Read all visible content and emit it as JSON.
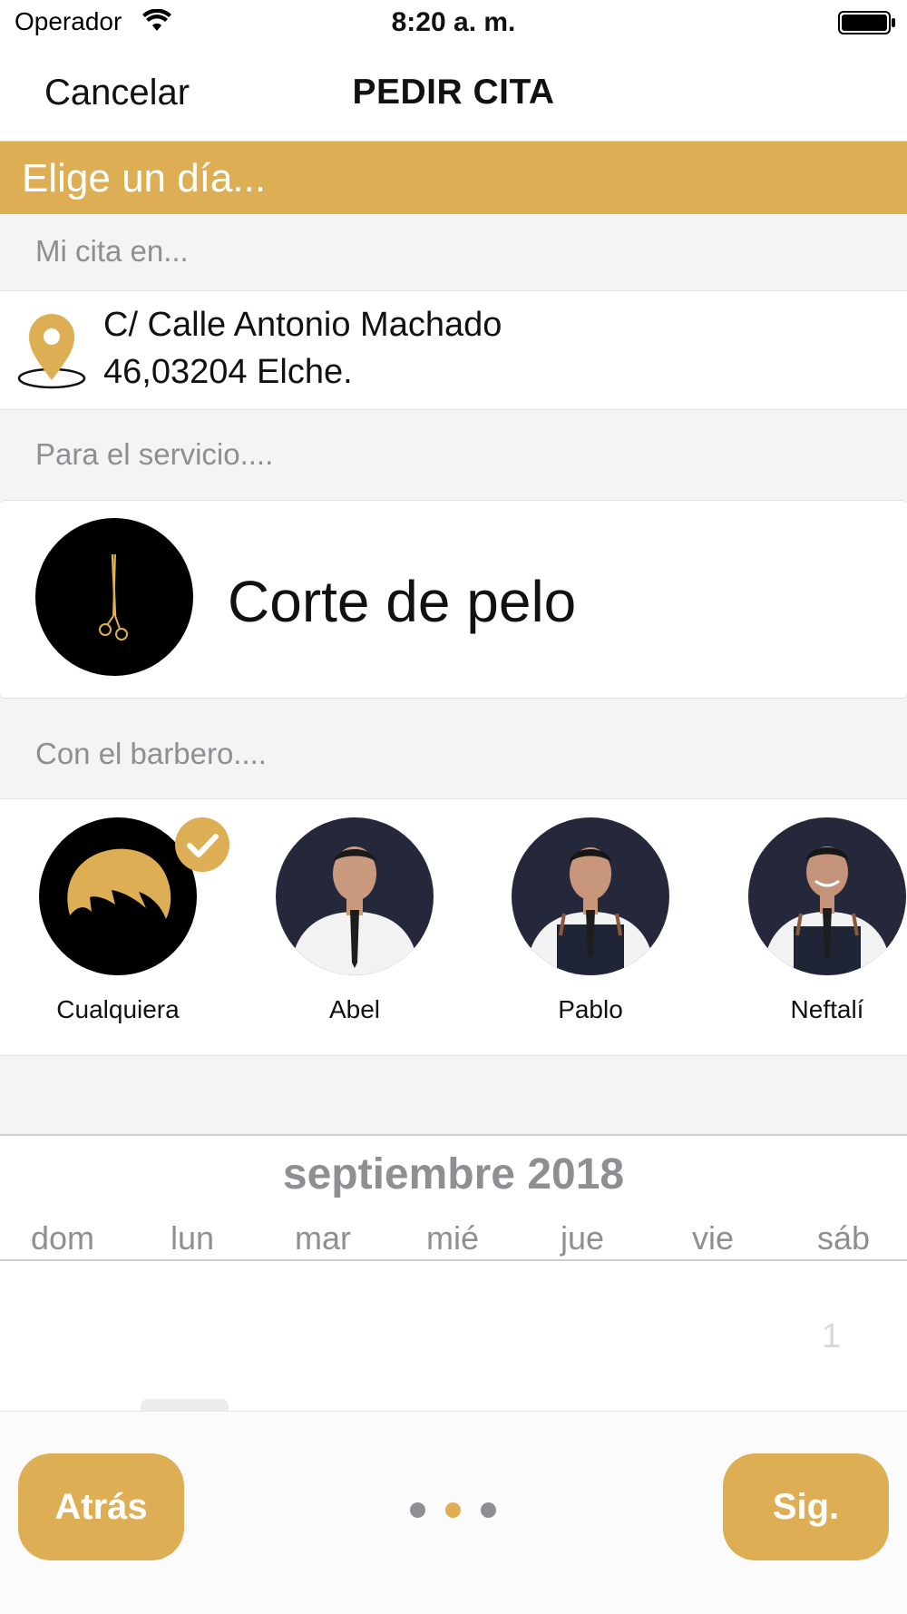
{
  "status_bar": {
    "carrier": "Operador",
    "time": "8:20 a. m."
  },
  "nav": {
    "cancel_label": "Cancelar",
    "title": "PEDIR CITA"
  },
  "banner": {
    "text": "Elige un día..."
  },
  "location": {
    "label": "Mi cita en...",
    "address_line1": "C/ Calle Antonio Machado",
    "address_line2": "46,03204 Elche."
  },
  "service": {
    "label": "Para el servicio....",
    "name": "Corte de pelo",
    "icon": "scissors-icon"
  },
  "barbers": {
    "label": "Con el barbero....",
    "items": [
      {
        "name": "Cualquiera",
        "selected": true,
        "icon": "hair-icon"
      },
      {
        "name": "Abel",
        "selected": false
      },
      {
        "name": "Pablo",
        "selected": false
      },
      {
        "name": "Neftalí",
        "selected": false
      }
    ]
  },
  "calendar": {
    "month": "septiembre 2018",
    "weekdays": [
      "dom",
      "lun",
      "mar",
      "mié",
      "jue",
      "vie",
      "sáb"
    ],
    "first_date": "1"
  },
  "footer": {
    "back_label": "Atrás",
    "next_label": "Sig.",
    "page_count": 3,
    "current_page": 2
  },
  "colors": {
    "accent": "#deae55",
    "muted_text": "#8e8e93",
    "dark": "#000000"
  }
}
